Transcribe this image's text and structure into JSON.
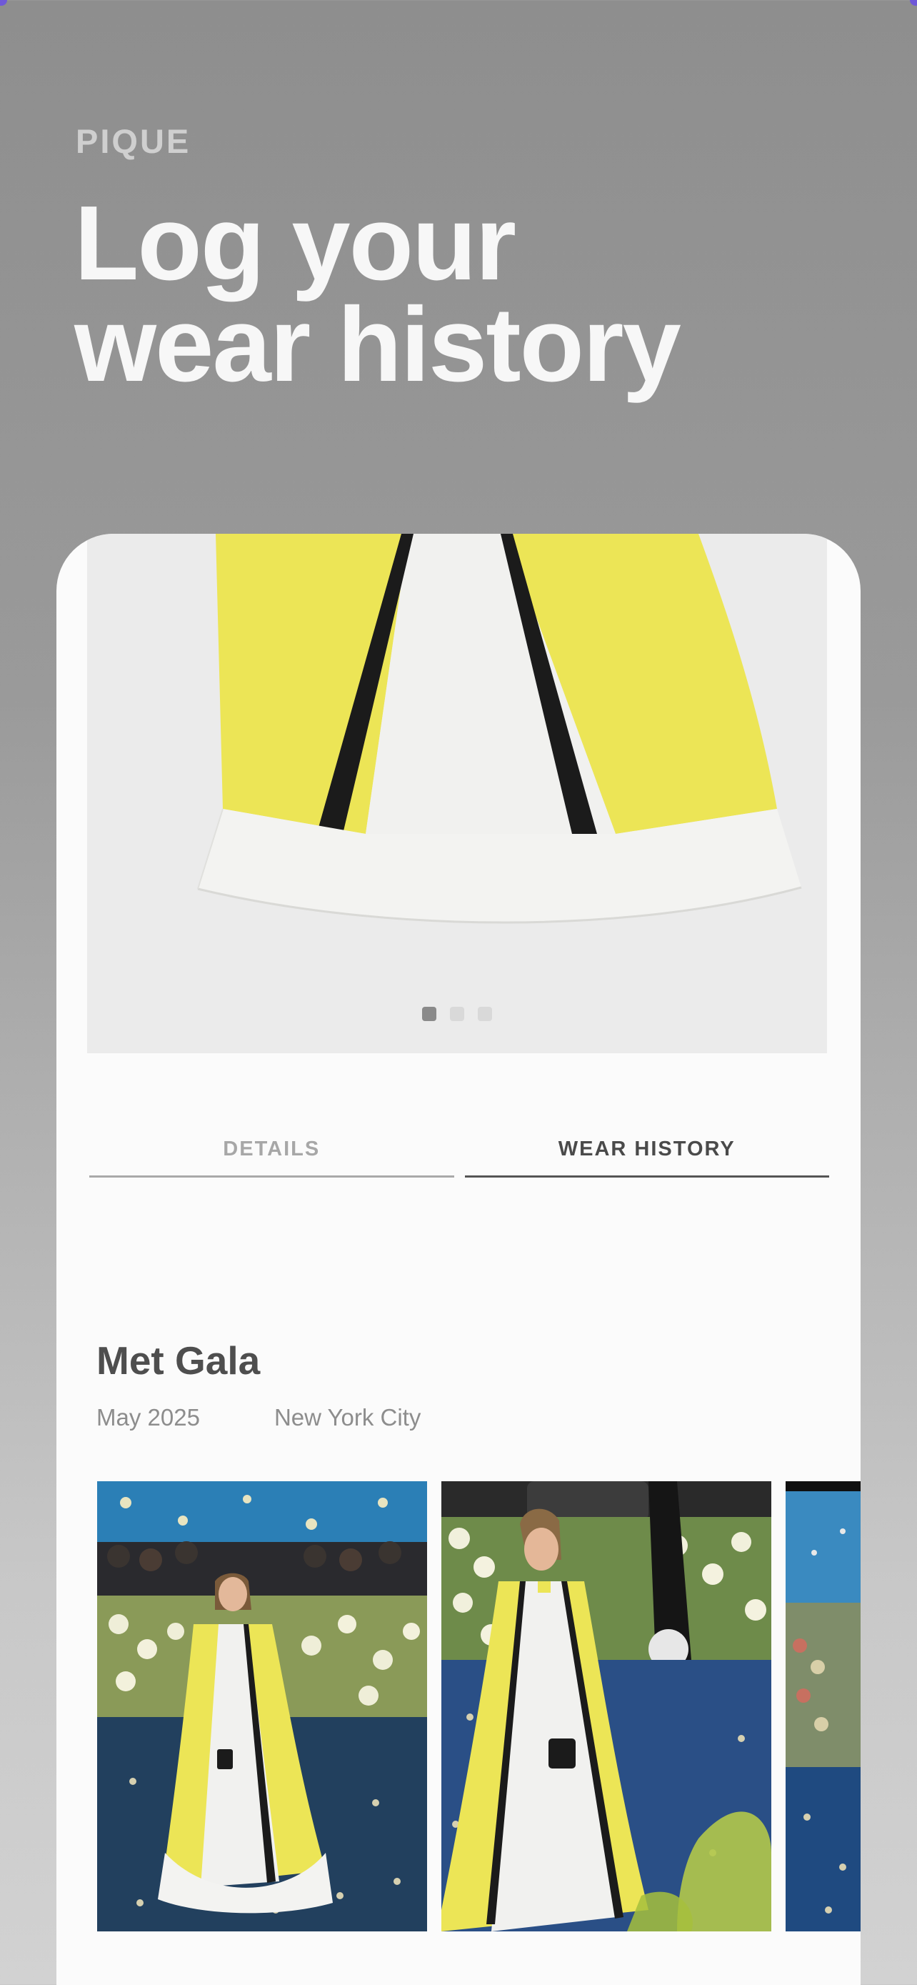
{
  "app": {
    "brand": "PIQUE",
    "headline_line1": "Log your",
    "headline_line2": "wear history"
  },
  "carousel": {
    "total": 3,
    "active_index": 0
  },
  "tabs": [
    {
      "label": "DETAILS",
      "active": false
    },
    {
      "label": "WEAR HISTORY",
      "active": true
    }
  ],
  "event": {
    "title": "Met Gala",
    "date": "May 2025",
    "location": "New York City"
  },
  "colors": {
    "garment_yellow": "#ece556",
    "garment_white": "#f2f2ef",
    "stripe_black": "#1b1b1b",
    "photo_sky": "#2b7fb6",
    "photo_carpet": "#22405e",
    "accent_purple": "#6f58d8"
  }
}
